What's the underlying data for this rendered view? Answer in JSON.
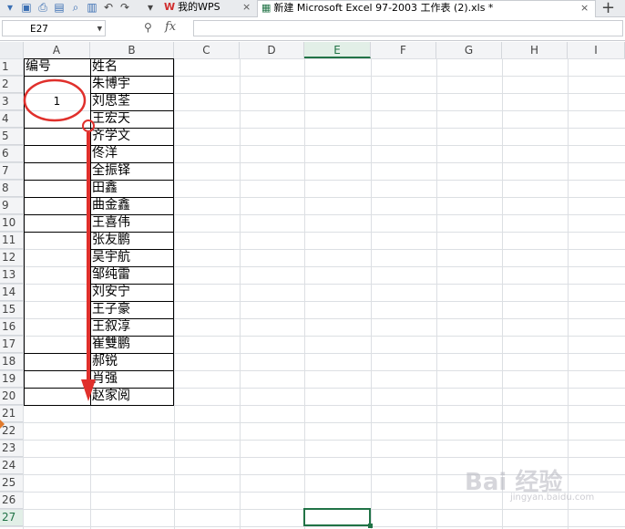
{
  "tabs": {
    "wps": "我的WPS",
    "file": "新建 Microsoft Excel 97-2003 工作表 (2).xls *"
  },
  "formula_bar": {
    "name_box": "E27",
    "fx": "fx",
    "formula": ""
  },
  "columns": [
    "A",
    "B",
    "C",
    "D",
    "E",
    "F",
    "G",
    "H",
    "I"
  ],
  "rows": [
    "1",
    "2",
    "3",
    "4",
    "5",
    "6",
    "7",
    "8",
    "9",
    "10",
    "11",
    "12",
    "13",
    "14",
    "15",
    "16",
    "17",
    "18",
    "19",
    "20",
    "21",
    "22",
    "23",
    "24",
    "25",
    "26",
    "27"
  ],
  "cells": {
    "A1": "编号",
    "A3": "1",
    "B1": "姓名",
    "B_names": [
      "朱博宇",
      "刘思荃",
      "王宏天",
      "齐学文",
      "佟洋",
      "全振铎",
      "田鑫",
      "曲金鑫",
      "王喜伟",
      "张友鹏",
      "吴宇航",
      "邹纯雷",
      "刘安宁",
      "王子豪",
      "王叙淳",
      "崔雙鹏",
      "郝锐",
      "肖强",
      "赵家阅"
    ]
  },
  "selected_cell": "E27",
  "watermark": {
    "text": "Bai 经验",
    "sub": "jingyan.baidu.com"
  },
  "colors": {
    "accent": "#217346",
    "annotation": "#e0302c"
  }
}
